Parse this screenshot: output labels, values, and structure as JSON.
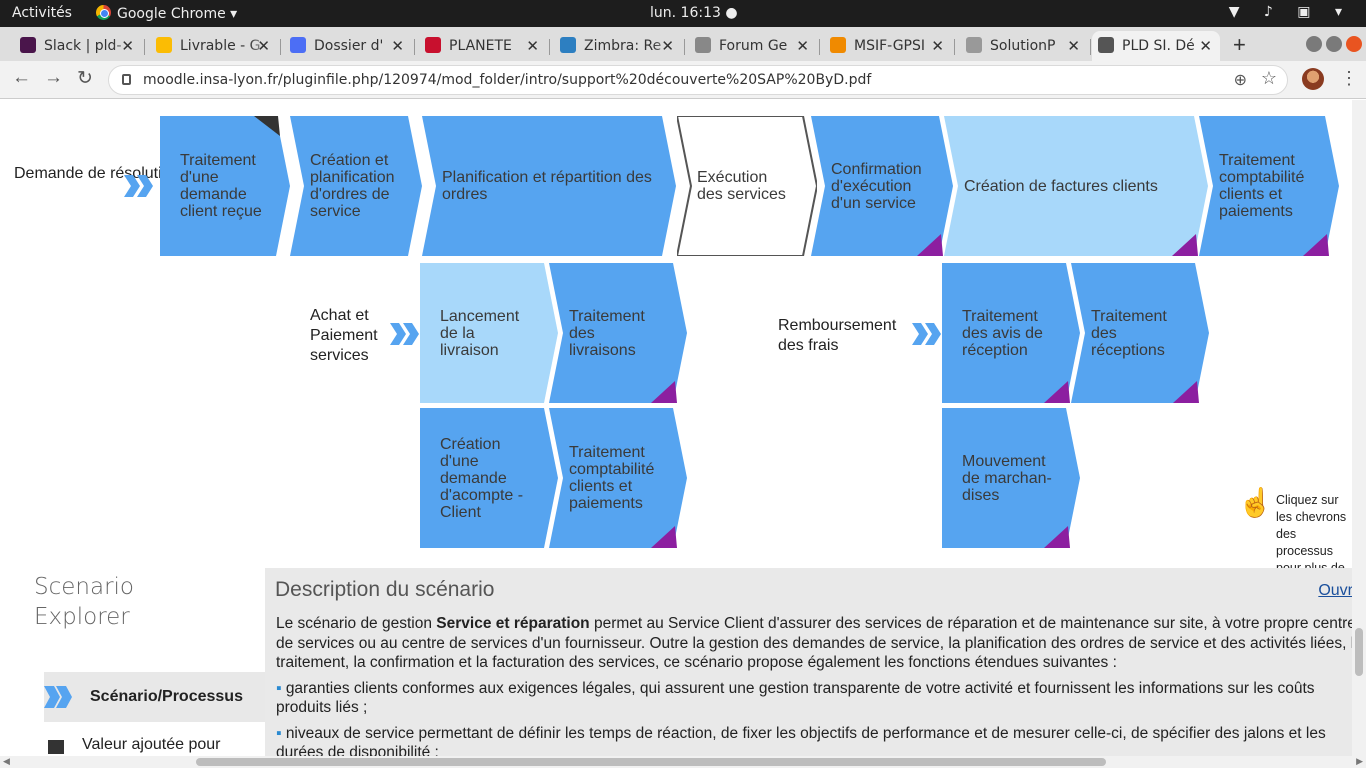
{
  "system": {
    "activities": "Activités",
    "app_name": "Google Chrome ▾",
    "clock": "lun. 16:13 ●",
    "tray": "▼ ♪ ▣ ▾"
  },
  "tabs": [
    {
      "title": "Slack | pld-",
      "color": "#4a154b"
    },
    {
      "title": "Livrable - G",
      "color": "#fbbc04"
    },
    {
      "title": "Dossier d'",
      "color": "#4c6ef5"
    },
    {
      "title": "PLANETE",
      "color": "#c8102e"
    },
    {
      "title": "Zimbra: Re",
      "color": "#2d7fc1"
    },
    {
      "title": "Forum Ge",
      "color": "#888"
    },
    {
      "title": "MSIF-GPSI",
      "color": "#f08a00"
    },
    {
      "title": "SolutionP",
      "color": "#999"
    },
    {
      "title": "PLD SI. Dé",
      "color": "#555"
    }
  ],
  "tab_close": "✕",
  "new_tab": "+",
  "toolbar": {
    "back": "←",
    "forward": "→",
    "reload": "↻",
    "url": "moodle.insa-lyon.fr/pluginfile.php/120974/mod_folder/intro/support%20découverte%20SAP%20ByD.pdf",
    "zoom_icon": "⊕",
    "star_icon": "☆",
    "menu_icon": "⋮"
  },
  "colors": {
    "blue": "#56a4f0",
    "light_blue": "#a8d8fa",
    "white": "#ffffff",
    "corner": "#8c1fa0"
  },
  "diagram": {
    "start_label": "Demande de résolution",
    "row1": [
      {
        "label": "Traitement d'une demande client reçue",
        "style": "blue"
      },
      {
        "label": "Création et planification d'ordres de service",
        "style": "blue"
      },
      {
        "label": "Planification et répartition des ordres",
        "style": "blue"
      },
      {
        "label": "Exécution des services",
        "style": "white"
      },
      {
        "label": "Confirmation d'exécution d'un service",
        "style": "blue"
      },
      {
        "label": "Création de factures clients",
        "style": "light"
      },
      {
        "label": "Traitement comptabilité clients et paiements",
        "style": "blue"
      }
    ],
    "purchase_label": "Achat et Paiement services",
    "purchase": [
      {
        "label": "Lancement de la livraison",
        "style": "light"
      },
      {
        "label": "Traitement des livraisons",
        "style": "blue"
      },
      {
        "label": "Création d'une demande d'acompte - Client",
        "style": "blue"
      },
      {
        "label": "Traitement comptabilité clients et paiements",
        "style": "blue"
      }
    ],
    "refund_label": "Remboursement des frais",
    "refund": [
      {
        "label": "Traitement des avis de réception",
        "style": "blue"
      },
      {
        "label": "Traitement des réceptions",
        "style": "blue"
      },
      {
        "label": "Mouvement de marchan-dises",
        "style": "blue"
      }
    ],
    "click_hint": "Cliquez sur les chevrons des processus pour plus de"
  },
  "scenario": {
    "explorer_title": "Scenario Explorer",
    "tab_label": "Scénario/Processus",
    "value_label": "Valeur ajoutée pour",
    "desc_title": "Description du scénario",
    "open_link": "Ouvr",
    "paragraph": "Le scénario de gestion Service et réparation permet au Service Client d'assurer des services de réparation et de maintenance sur site, à votre propre centre de services ou au centre de services d'un fournisseur. Outre la gestion des demandes de service, la planification des ordres de service et des activités liées, le traitement, la confirmation et la facturation des services, ce scénario propose également les fonctions étendues suivantes :",
    "bullet1": "garanties clients conformes aux exigences légales, qui assurent une gestion transparente de votre activité et fournissent les informations sur les coûts produits liés ;",
    "bullet2": "niveaux de service permettant de définir les temps de réaction, de fixer les objectifs de performance et de mesurer celle-ci, de spécifier des jalons et les durées de disponibilité ;"
  }
}
